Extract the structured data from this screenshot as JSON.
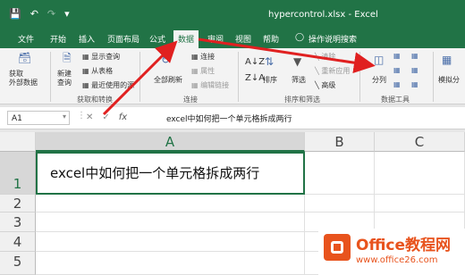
{
  "window": {
    "title": "hypercontrol.xlsx  -  Excel"
  },
  "tabs": [
    "文件",
    "开始",
    "插入",
    "页面布局",
    "公式",
    "数据",
    "审阅",
    "视图",
    "帮助",
    "操作说明搜索"
  ],
  "ribbon": {
    "get_external": "获取\n外部数据",
    "new_query": "新建\n查询",
    "show_query": "显示查询",
    "from_table": "从表格",
    "recent_sources": "最近使用的源",
    "group_get_transform": "获取和转换",
    "refresh_all": "全部刷新",
    "connections": "连接",
    "properties": "属性",
    "edit_links": "编辑链接",
    "group_connections": "连接",
    "sort": "排序",
    "filter": "筛选",
    "clear": "清除",
    "reapply": "重新应用",
    "advanced": "高级",
    "group_sort_filter": "排序和筛选",
    "text_to_columns": "分列",
    "group_data_tools": "数据工具",
    "what_if": "模拟分"
  },
  "formula_bar": {
    "name_box": "A1",
    "fx": "fx",
    "formula": "excel中如何把一个单元格拆成两行"
  },
  "columns": [
    "A",
    "B",
    "C"
  ],
  "rows": [
    "1",
    "2",
    "3",
    "4",
    "5"
  ],
  "cell_a1": "excel中如何把一个单元格拆成两行",
  "watermark": {
    "brand": "Office教程网",
    "site": "www.office26.com"
  },
  "colors": {
    "excel_green": "#217346",
    "arrow_red": "#e02020",
    "logo_orange": "#e8531d"
  }
}
